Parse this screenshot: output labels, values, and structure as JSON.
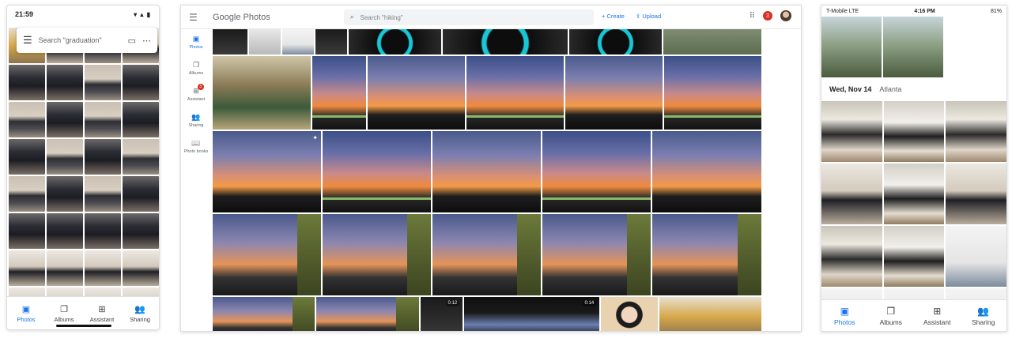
{
  "android": {
    "time": "21:59",
    "status_icons": "▾ ▴ ▮",
    "search_placeholder": "Search \"graduation\"",
    "nav": [
      {
        "label": "Photos",
        "icon": "photo-icon"
      },
      {
        "label": "Albums",
        "icon": "albums-icon"
      },
      {
        "label": "Assistant",
        "icon": "assistant-icon"
      },
      {
        "label": "Sharing",
        "icon": "sharing-icon"
      }
    ]
  },
  "web": {
    "logo_text": "Google Photos",
    "search_placeholder": "Search \"hiking\"",
    "create_label": "+ Create",
    "upload_label": "Upload",
    "notification_count": "3",
    "sidebar": [
      {
        "label": "Photos"
      },
      {
        "label": "Albums"
      },
      {
        "label": "Assistant",
        "badge": "3"
      },
      {
        "label": "Sharing"
      },
      {
        "label": "Photo books"
      }
    ],
    "video_durations": [
      "0:12",
      "0:14"
    ]
  },
  "ios": {
    "carrier": "T-Mobile  LTE",
    "time": "4:16 PM",
    "battery": "81%",
    "date_header": "Wed, Nov 14",
    "location": "Atlanta",
    "nav": [
      {
        "label": "Photos",
        "icon": "photo-icon"
      },
      {
        "label": "Albums",
        "icon": "albums-icon"
      },
      {
        "label": "Assistant",
        "icon": "assistant-icon"
      },
      {
        "label": "Sharing",
        "icon": "sharing-icon"
      }
    ]
  }
}
